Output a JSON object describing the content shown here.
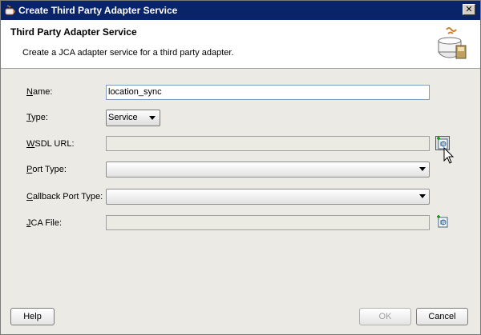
{
  "window": {
    "title": "Create Third Party Adapter Service",
    "close_label": "✕"
  },
  "banner": {
    "heading": "Third Party Adapter Service",
    "description": "Create a JCA adapter service for a third party adapter."
  },
  "form": {
    "name": {
      "label_prefix": "",
      "label_mnemonic": "N",
      "label_rest": "ame:",
      "value": "location_sync"
    },
    "type": {
      "label_mnemonic": "T",
      "label_rest": "ype:",
      "selected": "Service"
    },
    "wsdl_url": {
      "label_mnemonic": "W",
      "label_rest": "SDL URL:",
      "value": ""
    },
    "port_type": {
      "label_prefix": "",
      "label_mnemonic": "P",
      "label_rest": "ort Type:",
      "selected": ""
    },
    "callback_port_type": {
      "label_mnemonic": "C",
      "label_rest": "allback Port Type:",
      "selected": ""
    },
    "jca_file": {
      "label_mnemonic": "J",
      "label_rest": "CA File:",
      "value": ""
    }
  },
  "footer": {
    "help_label": "Help",
    "ok_label": "OK",
    "cancel_label": "Cancel"
  },
  "colors": {
    "titlebar": "#0a246a",
    "banner_bg": "#ffffff",
    "body_bg": "#eceae4"
  }
}
